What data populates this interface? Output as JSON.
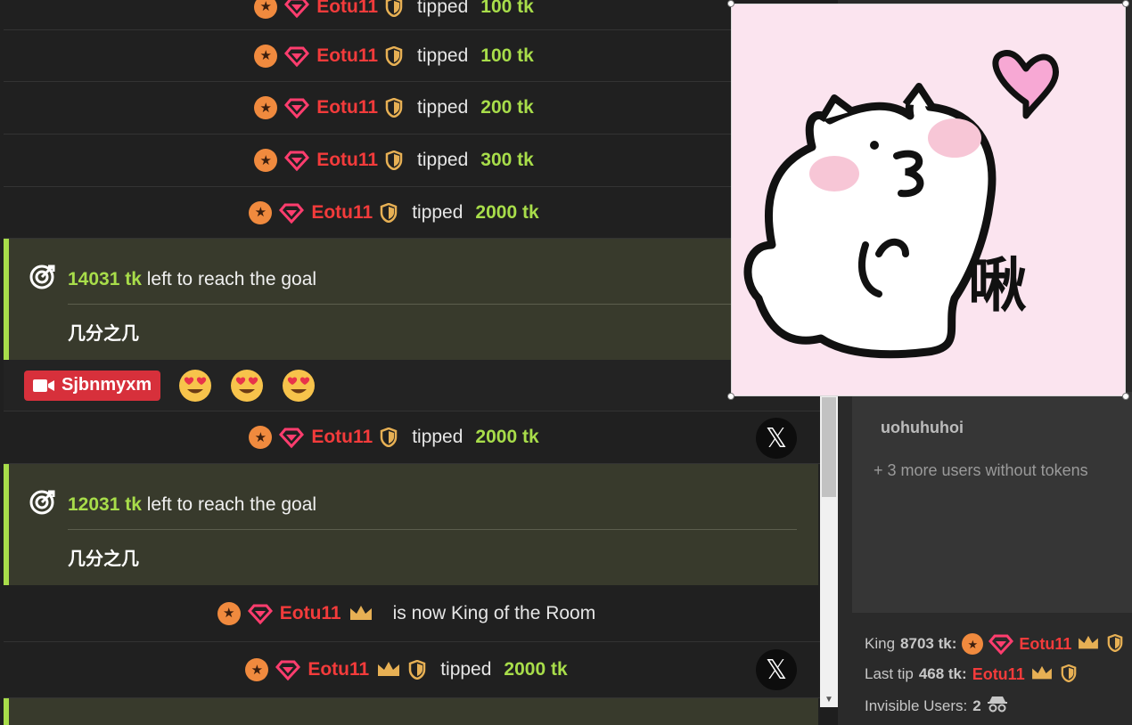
{
  "chat": {
    "tips": [
      {
        "user": "Eotu11",
        "verb": "tipped",
        "amount": "100 tk"
      },
      {
        "user": "Eotu11",
        "verb": "tipped",
        "amount": "100 tk"
      },
      {
        "user": "Eotu11",
        "verb": "tipped",
        "amount": "200 tk"
      },
      {
        "user": "Eotu11",
        "verb": "tipped",
        "amount": "300 tk"
      },
      {
        "user": "Eotu11",
        "verb": "tipped",
        "amount": "2000 tk"
      },
      {
        "user": "Eotu11",
        "verb": "tipped",
        "amount": "2000 tk"
      }
    ],
    "goals": [
      {
        "amount": "14031 tk",
        "text": "left to reach the goal",
        "subtitle": "几分之几"
      },
      {
        "amount": "12031 tk",
        "text": "left to reach the goal",
        "subtitle": "几分之几"
      }
    ],
    "emoji_message": {
      "user": "Sjbnmyxm",
      "emoji_count": 3,
      "emoji": "heart-eyes"
    },
    "king_message": {
      "user": "Eotu11",
      "text": "is now King of the Room"
    },
    "last_tip": {
      "user": "Eotu11",
      "verb": "tipped",
      "amount": "2000 tk"
    },
    "x_label": "𝕏"
  },
  "sidebar": {
    "user_name": "uohuhuhoi",
    "more_users": "+ 3 more users without tokens",
    "king_label": "King",
    "king_amount": "8703 tk:",
    "king_user": "Eotu11",
    "last_tip_label": "Last tip",
    "last_tip_amount": "468 tk:",
    "last_tip_user": "Eotu11",
    "invisible_label": "Invisible Users:",
    "invisible_count": "2"
  },
  "sticker": {
    "caption": "啾"
  },
  "colors": {
    "accent_green": "#a8dd4a",
    "user_red": "#f33b3b",
    "goal_bg": "#383a2c",
    "cam_badge": "#d7303b",
    "star_badge": "#f08a3e"
  }
}
